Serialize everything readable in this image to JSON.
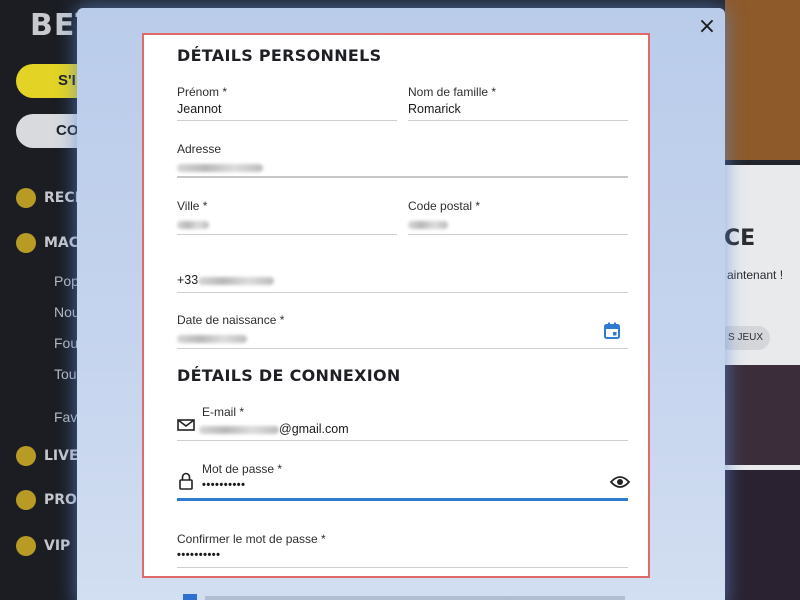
{
  "background": {
    "logo_text": "BET",
    "btn_primary": "S'I",
    "btn_secondary": "CO",
    "nav": [
      {
        "label": "RECH",
        "icon": "search-icon"
      },
      {
        "label": "MAC",
        "icon": "slot-machine-icon"
      },
      {
        "label": "LIVE",
        "icon": "chip-icon"
      },
      {
        "label": "PRO",
        "icon": "trophy-icon"
      },
      {
        "label": "VIP",
        "icon": "top-hat-icon"
      }
    ],
    "sub_items": [
      "Pop",
      "Nou",
      "Fou",
      "Tou",
      "Fav"
    ],
    "right_title": "CE",
    "right_text": "aintenant !",
    "right_pill": "S JEUX"
  },
  "modal": {
    "close_label": "×",
    "section_personal": "DÉTAILS PERSONNELS",
    "section_login": "DÉTAILS DE CONNEXION",
    "fields": {
      "first_name": {
        "label": "Prénom *",
        "value": "Jeannot"
      },
      "last_name": {
        "label": "Nom de famille *",
        "value": "Romarick"
      },
      "address": {
        "label": "Adresse"
      },
      "city": {
        "label": "Ville *"
      },
      "postal_code": {
        "label": "Code postal *"
      },
      "phone": {
        "prefix": "+33"
      },
      "birth_date": {
        "label": "Date de naissance *"
      },
      "email": {
        "label": "E-mail *",
        "suffix": "@gmail.com"
      },
      "password": {
        "label": "Mot de passe *",
        "value": "••••••••••"
      },
      "confirm_password": {
        "label": "Confirmer le mot de passe *",
        "value": "••••••••••"
      }
    }
  },
  "colors": {
    "accent": "#2f7bd3",
    "card_border": "#e06a6a"
  }
}
